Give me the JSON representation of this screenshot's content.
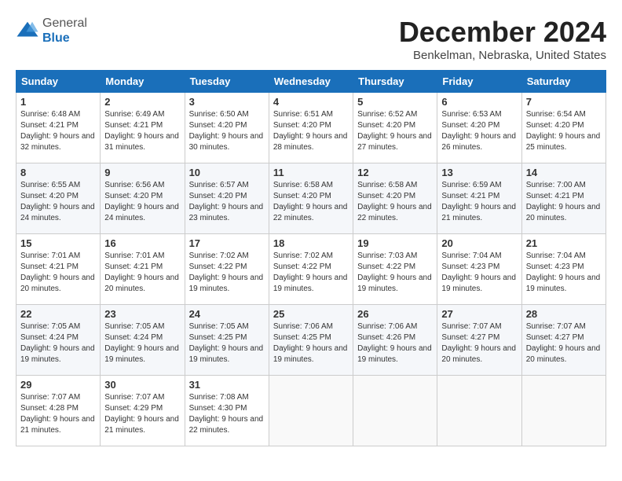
{
  "logo": {
    "general": "General",
    "blue": "Blue"
  },
  "header": {
    "month": "December 2024",
    "location": "Benkelman, Nebraska, United States"
  },
  "weekdays": [
    "Sunday",
    "Monday",
    "Tuesday",
    "Wednesday",
    "Thursday",
    "Friday",
    "Saturday"
  ],
  "weeks": [
    [
      {
        "day": "1",
        "sunrise": "6:48 AM",
        "sunset": "4:21 PM",
        "daylight": "9 hours and 32 minutes."
      },
      {
        "day": "2",
        "sunrise": "6:49 AM",
        "sunset": "4:21 PM",
        "daylight": "9 hours and 31 minutes."
      },
      {
        "day": "3",
        "sunrise": "6:50 AM",
        "sunset": "4:20 PM",
        "daylight": "9 hours and 30 minutes."
      },
      {
        "day": "4",
        "sunrise": "6:51 AM",
        "sunset": "4:20 PM",
        "daylight": "9 hours and 28 minutes."
      },
      {
        "day": "5",
        "sunrise": "6:52 AM",
        "sunset": "4:20 PM",
        "daylight": "9 hours and 27 minutes."
      },
      {
        "day": "6",
        "sunrise": "6:53 AM",
        "sunset": "4:20 PM",
        "daylight": "9 hours and 26 minutes."
      },
      {
        "day": "7",
        "sunrise": "6:54 AM",
        "sunset": "4:20 PM",
        "daylight": "9 hours and 25 minutes."
      }
    ],
    [
      {
        "day": "8",
        "sunrise": "6:55 AM",
        "sunset": "4:20 PM",
        "daylight": "9 hours and 24 minutes."
      },
      {
        "day": "9",
        "sunrise": "6:56 AM",
        "sunset": "4:20 PM",
        "daylight": "9 hours and 24 minutes."
      },
      {
        "day": "10",
        "sunrise": "6:57 AM",
        "sunset": "4:20 PM",
        "daylight": "9 hours and 23 minutes."
      },
      {
        "day": "11",
        "sunrise": "6:58 AM",
        "sunset": "4:20 PM",
        "daylight": "9 hours and 22 minutes."
      },
      {
        "day": "12",
        "sunrise": "6:58 AM",
        "sunset": "4:20 PM",
        "daylight": "9 hours and 22 minutes."
      },
      {
        "day": "13",
        "sunrise": "6:59 AM",
        "sunset": "4:21 PM",
        "daylight": "9 hours and 21 minutes."
      },
      {
        "day": "14",
        "sunrise": "7:00 AM",
        "sunset": "4:21 PM",
        "daylight": "9 hours and 20 minutes."
      }
    ],
    [
      {
        "day": "15",
        "sunrise": "7:01 AM",
        "sunset": "4:21 PM",
        "daylight": "9 hours and 20 minutes."
      },
      {
        "day": "16",
        "sunrise": "7:01 AM",
        "sunset": "4:21 PM",
        "daylight": "9 hours and 20 minutes."
      },
      {
        "day": "17",
        "sunrise": "7:02 AM",
        "sunset": "4:22 PM",
        "daylight": "9 hours and 19 minutes."
      },
      {
        "day": "18",
        "sunrise": "7:02 AM",
        "sunset": "4:22 PM",
        "daylight": "9 hours and 19 minutes."
      },
      {
        "day": "19",
        "sunrise": "7:03 AM",
        "sunset": "4:22 PM",
        "daylight": "9 hours and 19 minutes."
      },
      {
        "day": "20",
        "sunrise": "7:04 AM",
        "sunset": "4:23 PM",
        "daylight": "9 hours and 19 minutes."
      },
      {
        "day": "21",
        "sunrise": "7:04 AM",
        "sunset": "4:23 PM",
        "daylight": "9 hours and 19 minutes."
      }
    ],
    [
      {
        "day": "22",
        "sunrise": "7:05 AM",
        "sunset": "4:24 PM",
        "daylight": "9 hours and 19 minutes."
      },
      {
        "day": "23",
        "sunrise": "7:05 AM",
        "sunset": "4:24 PM",
        "daylight": "9 hours and 19 minutes."
      },
      {
        "day": "24",
        "sunrise": "7:05 AM",
        "sunset": "4:25 PM",
        "daylight": "9 hours and 19 minutes."
      },
      {
        "day": "25",
        "sunrise": "7:06 AM",
        "sunset": "4:25 PM",
        "daylight": "9 hours and 19 minutes."
      },
      {
        "day": "26",
        "sunrise": "7:06 AM",
        "sunset": "4:26 PM",
        "daylight": "9 hours and 19 minutes."
      },
      {
        "day": "27",
        "sunrise": "7:07 AM",
        "sunset": "4:27 PM",
        "daylight": "9 hours and 20 minutes."
      },
      {
        "day": "28",
        "sunrise": "7:07 AM",
        "sunset": "4:27 PM",
        "daylight": "9 hours and 20 minutes."
      }
    ],
    [
      {
        "day": "29",
        "sunrise": "7:07 AM",
        "sunset": "4:28 PM",
        "daylight": "9 hours and 21 minutes."
      },
      {
        "day": "30",
        "sunrise": "7:07 AM",
        "sunset": "4:29 PM",
        "daylight": "9 hours and 21 minutes."
      },
      {
        "day": "31",
        "sunrise": "7:08 AM",
        "sunset": "4:30 PM",
        "daylight": "9 hours and 22 minutes."
      },
      null,
      null,
      null,
      null
    ]
  ]
}
